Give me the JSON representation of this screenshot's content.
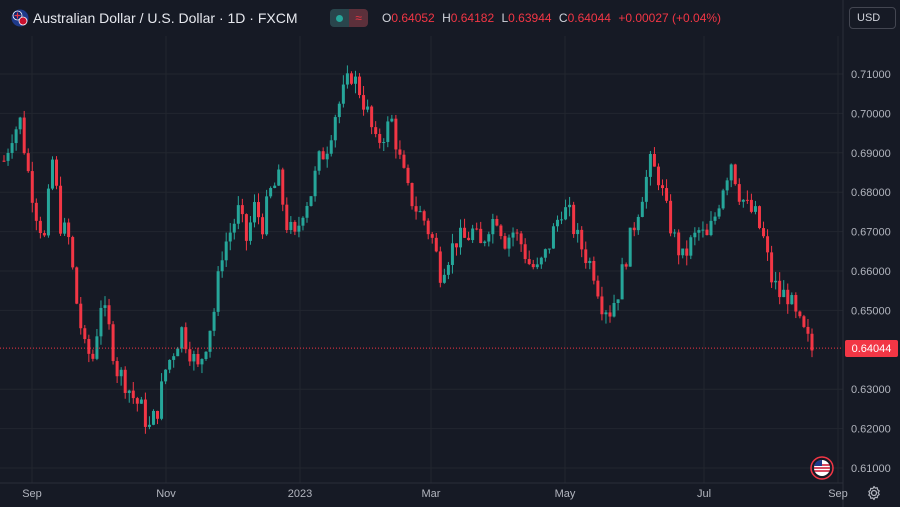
{
  "header": {
    "title": "Australian Dollar / U.S. Dollar · 1D · FXCM",
    "ohlc": {
      "open_label": "O",
      "open": "0.64052",
      "high_label": "H",
      "high": "0.64182",
      "low_label": "L",
      "low": "0.63944",
      "close_label": "C",
      "close": "0.64044",
      "change": "+0.00027 (+0.04%)"
    },
    "pill_red_symbol": "≈",
    "currency": "USD"
  },
  "price_label": "0.64044",
  "colors": {
    "up": "#26a69a",
    "down": "#f23645",
    "bg": "#161a25",
    "grid": "#22262f"
  },
  "icons": {
    "flag": "aud-usd-flag-icon",
    "gear": "gear-icon",
    "events": "us-flag-icon"
  },
  "chart_data": {
    "type": "candlestick",
    "symbol": "AUDUSD",
    "interval": "1D",
    "x_ticks": [
      "Sep",
      "Nov",
      "2023",
      "Mar",
      "May",
      "Jul",
      "Sep"
    ],
    "y_ticks": [
      "0.71000",
      "0.70000",
      "0.69000",
      "0.68000",
      "0.67000",
      "0.66000",
      "0.65000",
      "0.63000",
      "0.62000",
      "0.61000"
    ],
    "ylim": [
      0.6065,
      0.7195
    ],
    "last_price": 0.64044,
    "grid": true,
    "closes_path": [
      [
        0,
        0.688
      ],
      [
        4,
        0.695
      ],
      [
        8,
        0.698
      ],
      [
        12,
        0.685
      ],
      [
        16,
        0.675
      ],
      [
        20,
        0.668
      ],
      [
        24,
        0.688
      ],
      [
        28,
        0.672
      ],
      [
        32,
        0.668
      ],
      [
        36,
        0.652
      ],
      [
        40,
        0.64
      ],
      [
        44,
        0.638
      ],
      [
        48,
        0.652
      ],
      [
        52,
        0.645
      ],
      [
        56,
        0.635
      ],
      [
        60,
        0.632
      ],
      [
        64,
        0.628
      ],
      [
        68,
        0.625
      ],
      [
        72,
        0.62
      ],
      [
        76,
        0.625
      ],
      [
        80,
        0.635
      ],
      [
        84,
        0.64
      ],
      [
        88,
        0.645
      ],
      [
        92,
        0.64
      ],
      [
        96,
        0.635
      ],
      [
        100,
        0.642
      ],
      [
        104,
        0.65
      ],
      [
        108,
        0.665
      ],
      [
        112,
        0.67
      ],
      [
        116,
        0.675
      ],
      [
        120,
        0.668
      ],
      [
        124,
        0.676
      ],
      [
        128,
        0.672
      ],
      [
        132,
        0.68
      ],
      [
        136,
        0.683
      ],
      [
        140,
        0.672
      ],
      [
        144,
        0.668
      ],
      [
        148,
        0.676
      ],
      [
        152,
        0.68
      ],
      [
        156,
        0.688
      ],
      [
        160,
        0.692
      ],
      [
        164,
        0.7
      ],
      [
        168,
        0.705
      ],
      [
        172,
        0.71
      ],
      [
        176,
        0.706
      ],
      [
        180,
        0.7
      ],
      [
        184,
        0.692
      ],
      [
        188,
        0.695
      ],
      [
        192,
        0.698
      ],
      [
        196,
        0.688
      ],
      [
        200,
        0.68
      ],
      [
        204,
        0.676
      ],
      [
        208,
        0.673
      ],
      [
        212,
        0.668
      ],
      [
        216,
        0.66
      ],
      [
        220,
        0.664
      ],
      [
        224,
        0.668
      ],
      [
        228,
        0.668
      ],
      [
        232,
        0.67
      ],
      [
        236,
        0.666
      ],
      [
        240,
        0.672
      ],
      [
        244,
        0.674
      ],
      [
        248,
        0.668
      ],
      [
        252,
        0.67
      ],
      [
        256,
        0.667
      ],
      [
        260,
        0.662
      ],
      [
        264,
        0.66
      ],
      [
        268,
        0.664
      ],
      [
        272,
        0.67
      ],
      [
        276,
        0.676
      ],
      [
        280,
        0.674
      ],
      [
        284,
        0.668
      ],
      [
        288,
        0.664
      ],
      [
        292,
        0.66
      ],
      [
        296,
        0.652
      ],
      [
        300,
        0.65
      ],
      [
        304,
        0.655
      ],
      [
        308,
        0.664
      ],
      [
        312,
        0.672
      ],
      [
        316,
        0.68
      ],
      [
        320,
        0.687
      ],
      [
        324,
        0.684
      ],
      [
        328,
        0.675
      ],
      [
        332,
        0.668
      ],
      [
        336,
        0.663
      ],
      [
        340,
        0.667
      ],
      [
        344,
        0.67
      ],
      [
        348,
        0.668
      ],
      [
        352,
        0.674
      ],
      [
        356,
        0.682
      ],
      [
        360,
        0.688
      ],
      [
        364,
        0.68
      ],
      [
        368,
        0.676
      ],
      [
        372,
        0.674
      ],
      [
        376,
        0.668
      ],
      [
        380,
        0.658
      ],
      [
        384,
        0.654
      ],
      [
        388,
        0.654
      ],
      [
        392,
        0.648
      ],
      [
        396,
        0.644
      ],
      [
        400,
        0.64
      ]
    ]
  }
}
